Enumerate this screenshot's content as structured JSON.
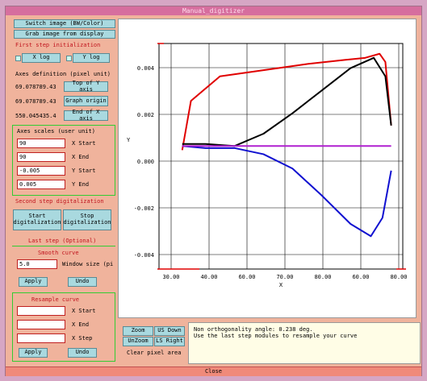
{
  "window": {
    "title": "Manual_digitizer",
    "close_label": "Close"
  },
  "left": {
    "switch_image": "Switch image (BW/Color)",
    "grab_image": "Grab image from display",
    "first_step": "First step initialization",
    "xlog": "X log",
    "ylog": "Y log",
    "axes_def": "Axes definition (pixel unit)",
    "top_x_val": "69.078789.43",
    "top_x_btn": "Top of Y axis",
    "origin_val": "69.078789.43",
    "origin_btn": "Graph origin",
    "end_x_val": "550.045435.4",
    "end_x_btn": "End of X axis",
    "axes_scales": "Axes scales (user unit)",
    "x_start_val": "90",
    "x_start_lbl": "X Start",
    "x_end_val": "90",
    "x_end_lbl": "X End",
    "y_start_val": "-0.005",
    "y_start_lbl": "Y Start",
    "y_end_val": "0.005",
    "y_end_lbl": "Y End",
    "second_step": "Second step digitalization",
    "start_btn": "Start digitalization",
    "stop_btn": "Stop digitalization",
    "last_step": "Last step (Optional)",
    "smooth_curve": "Smooth curve",
    "window_size_val": "5.0",
    "window_size_lbl": "Window size (pi",
    "apply1": "Apply",
    "undo1": "Undo",
    "resample": "Resample curve",
    "r_x_start": "X Start",
    "r_x_end": "X End",
    "r_x_step": "X Step",
    "apply2": "Apply",
    "undo2": "Undo"
  },
  "bottom": {
    "zoom": "Zoom",
    "unzoom": "UnZoom",
    "us_down": "US Down",
    "ls_right": "LS Right",
    "clear_pixel": "Clear pixel area",
    "info_line1": "Non orthogonality angle:      0.238 deg.",
    "info_line2": "Use the last step modules to resample your curve"
  },
  "chart_data": {
    "type": "line",
    "xlabel": "X",
    "ylabel": "Y",
    "x_ticks": [
      "30.00",
      "40.00",
      "60.00",
      "70.00",
      "80.00",
      "60.00",
      "80.00"
    ],
    "y_ticks": [
      "0.004",
      "0.002",
      "0.000",
      "-0.002",
      "-0.004"
    ],
    "series": [
      {
        "color": "#e00000",
        "values": [
          [
            32,
            -0.0002
          ],
          [
            35,
            0.0022
          ],
          [
            45,
            0.0034
          ],
          [
            60,
            0.0037
          ],
          [
            75,
            0.004
          ],
          [
            88,
            0.0042
          ],
          [
            95,
            0.0043
          ],
          [
            100,
            0.0045
          ],
          [
            102,
            0.0041
          ],
          [
            104,
            0.001
          ]
        ]
      },
      {
        "color": "#000000",
        "values": [
          [
            32,
            0.0001
          ],
          [
            40,
            0.0001
          ],
          [
            50,
            0.0
          ],
          [
            60,
            0.0006
          ],
          [
            70,
            0.0016
          ],
          [
            80,
            0.0027
          ],
          [
            90,
            0.0038
          ],
          [
            98,
            0.0043
          ],
          [
            102,
            0.0034
          ],
          [
            104,
            0.001
          ]
        ]
      },
      {
        "color": "#1010d0",
        "values": [
          [
            32,
            0.0
          ],
          [
            40,
            -0.0001
          ],
          [
            50,
            -0.0001
          ],
          [
            60,
            -0.0004
          ],
          [
            70,
            -0.0011
          ],
          [
            80,
            -0.0024
          ],
          [
            90,
            -0.0038
          ],
          [
            97,
            -0.0044
          ],
          [
            101,
            -0.0035
          ],
          [
            104,
            -0.0012
          ]
        ]
      },
      {
        "color": "#b020d0",
        "values": [
          [
            32,
            0.0
          ],
          [
            104,
            0.0
          ]
        ]
      }
    ]
  }
}
